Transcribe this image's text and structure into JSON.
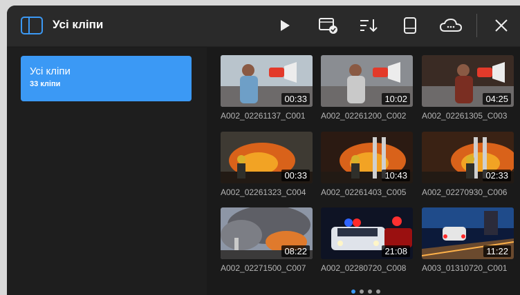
{
  "header": {
    "title": "Усі кліпи"
  },
  "sidebar": {
    "items": [
      {
        "label": "Усі кліпи",
        "count": "33 кліпи"
      }
    ]
  },
  "clips": [
    {
      "name": "A002_02261137_C001",
      "duration": "00:33",
      "scene": "protest"
    },
    {
      "name": "A002_02261200_C002",
      "duration": "10:02",
      "scene": "protest"
    },
    {
      "name": "A002_02261305_C003",
      "duration": "04:25",
      "scene": "protest"
    },
    {
      "name": "A002_02261323_C004",
      "duration": "00:33",
      "scene": "fire"
    },
    {
      "name": "A002_02261403_C005",
      "duration": "10:43",
      "scene": "fire"
    },
    {
      "name": "A002_02270930_C006",
      "duration": "02:33",
      "scene": "fire"
    },
    {
      "name": "A002_02271500_C007",
      "duration": "08:22",
      "scene": "smoke"
    },
    {
      "name": "A002_02280720_C008",
      "duration": "21:08",
      "scene": "police"
    },
    {
      "name": "A003_01310720_C001",
      "duration": "11:22",
      "scene": "street"
    }
  ],
  "pagination": {
    "pages": 4,
    "current": 1
  },
  "colors": {
    "accent": "#3b99f5",
    "bar": "#2a2a2a",
    "background": "#1b1b1b"
  }
}
